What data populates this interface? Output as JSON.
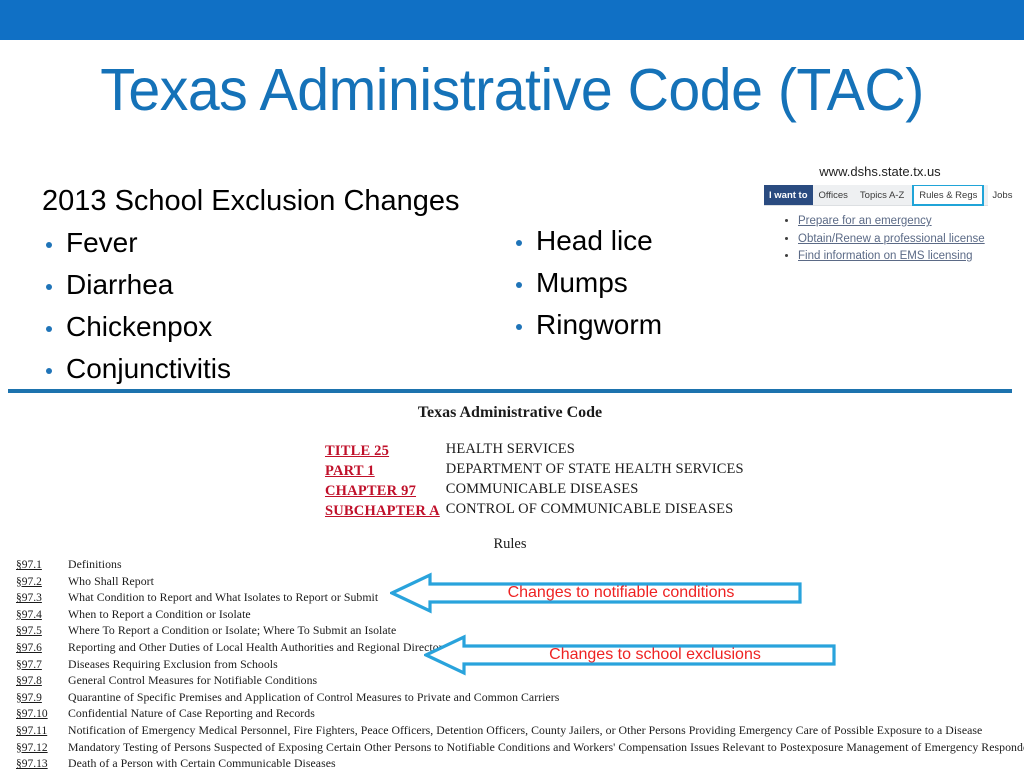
{
  "slide": {
    "title": "Texas Administrative Code (TAC)",
    "banner_color": "#1070c5",
    "title_color": "#1572b8",
    "divider_color": "#1d73ae"
  },
  "bullets": {
    "heading": "2013 School Exclusion Changes",
    "left_items": [
      "Fever",
      "Diarrhea",
      "Chickenpox",
      "Conjunctivitis"
    ],
    "right_items": [
      "Head lice",
      "Mumps",
      "Ringworm"
    ],
    "bullet_color": "#1f74b8"
  },
  "site_thumbnail": {
    "url": "www.dshs.state.tx.us",
    "nav": {
      "pill_label": "I want to",
      "pill_color": "#2a4b80",
      "tabs": [
        {
          "label": "Offices",
          "highlighted": false
        },
        {
          "label": "Topics A-Z",
          "highlighted": false
        },
        {
          "label": "Rules & Regs",
          "highlighted": true
        },
        {
          "label": "Jobs",
          "highlighted": false
        }
      ],
      "highlight_color": "#20a4d8"
    },
    "links": [
      "Prepare for an emergency",
      "Obtain/Renew a professional license",
      "Find information on EMS licensing"
    ]
  },
  "tac_document": {
    "title": "Texas Administrative Code",
    "key_color": "#c0102a",
    "entries": [
      {
        "key": "TITLE 25",
        "value": "HEALTH SERVICES"
      },
      {
        "key": "PART 1",
        "value": "DEPARTMENT OF STATE HEALTH SERVICES"
      },
      {
        "key": "CHAPTER 97",
        "value": "COMMUNICABLE DISEASES"
      },
      {
        "key": "SUBCHAPTER A",
        "value": "CONTROL OF COMMUNICABLE DISEASES"
      }
    ],
    "rules_label": "Rules",
    "rules": [
      {
        "number": "§97.1",
        "text": "Definitions"
      },
      {
        "number": "§97.2",
        "text": "Who Shall Report"
      },
      {
        "number": "§97.3",
        "text": "What Condition to Report and What Isolates to Report or Submit"
      },
      {
        "number": "§97.4",
        "text": "When to Report a Condition or Isolate"
      },
      {
        "number": "§97.5",
        "text": "Where To Report a Condition or Isolate; Where To Submit an Isolate"
      },
      {
        "number": "§97.6",
        "text": "Reporting and Other Duties of Local Health Authorities and Regional Directors"
      },
      {
        "number": "§97.7",
        "text": "Diseases Requiring Exclusion from Schools"
      },
      {
        "number": "§97.8",
        "text": "General Control Measures for Notifiable Conditions"
      },
      {
        "number": "§97.9",
        "text": "Quarantine of Specific Premises and Application of Control Measures to Private and Common Carriers"
      },
      {
        "number": "§97.10",
        "text": "Confidential Nature of Case Reporting and Records"
      },
      {
        "number": "§97.11",
        "text": "Notification of Emergency Medical Personnel, Fire Fighters, Peace Officers, Detention Officers, County Jailers, or Other Persons Providing Emergency Care of Possible Exposure to a Disease"
      },
      {
        "number": "§97.12",
        "text": "Mandatory Testing of Persons Suspected of Exposing Certain Other Persons to Notifiable Conditions and Workers' Compensation Issues Relevant to Postexposure Management of Emergency Responders"
      },
      {
        "number": "§97.13",
        "text": "Death of a Person with Certain Communicable Diseases"
      }
    ]
  },
  "callouts": [
    {
      "label": "Changes to notifiable conditions",
      "outline_color": "#29a3dc",
      "text_color": "#ee2222"
    },
    {
      "label": "Changes to school exclusions",
      "outline_color": "#29a3dc",
      "text_color": "#ee2222"
    }
  ]
}
